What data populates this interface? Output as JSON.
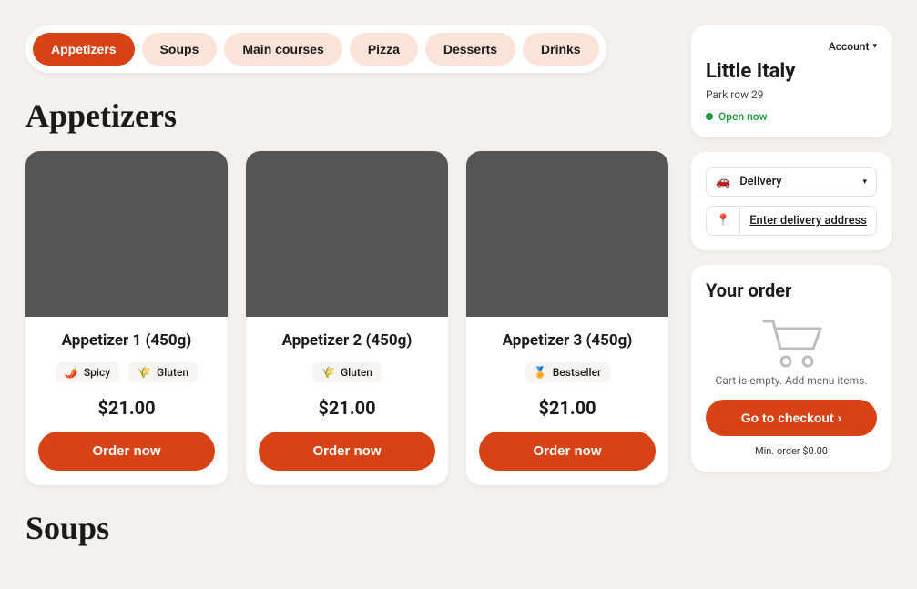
{
  "tabs": [
    "Appetizers",
    "Soups",
    "Main courses",
    "Pizza",
    "Desserts",
    "Drinks"
  ],
  "active_tab_index": 0,
  "section1_title": "Appetizers",
  "section2_title": "Soups",
  "items": [
    {
      "title": "Appetizer 1 (450g)",
      "chips": [
        {
          "icon": "🌶️",
          "label": "Spicy"
        },
        {
          "icon": "🌾",
          "label": "Gluten"
        }
      ],
      "price": "$21.00",
      "order_label": "Order now"
    },
    {
      "title": "Appetizer 2 (450g)",
      "chips": [
        {
          "icon": "🌾",
          "label": "Gluten"
        }
      ],
      "price": "$21.00",
      "order_label": "Order now"
    },
    {
      "title": "Appetizer 3 (450g)",
      "chips": [
        {
          "icon": "🏅",
          "label": "Bestseller"
        }
      ],
      "price": "$21.00",
      "order_label": "Order now"
    }
  ],
  "account_label": "Account",
  "restaurant": {
    "name": "Little Italy",
    "address": "Park row 29",
    "status": "Open now"
  },
  "delivery": {
    "mode_label": "Delivery",
    "address_prompt": "Enter delivery address"
  },
  "order": {
    "heading": "Your order",
    "empty_text": "Cart is empty. Add menu items.",
    "checkout_label": "Go to checkout",
    "min_order": "Min. order $0.00"
  }
}
